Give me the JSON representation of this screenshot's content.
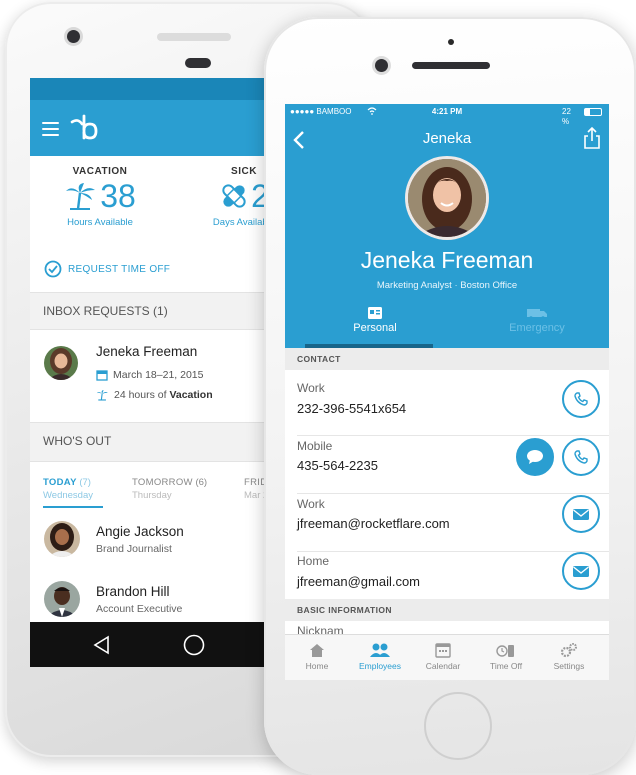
{
  "colors": {
    "accent": "#2a9ed1",
    "accent_dark": "#1a86b8"
  },
  "android": {
    "balances": [
      {
        "title": "VACATION",
        "value": "38",
        "subtitle": "Hours Available",
        "icon": "palm-tree-icon"
      },
      {
        "title": "SICK",
        "value": "2",
        "subtitle": "Days Available",
        "icon": "bandage-icon"
      }
    ],
    "request_time_off": "REQUEST TIME OFF",
    "inbox_header": "INBOX REQUESTS (1)",
    "inbox_request": {
      "name": "Jeneka Freeman",
      "dates": "March 18–21, 2015",
      "hours_prefix": "24 hours of ",
      "hours_type": "Vacation"
    },
    "whos_out_header": "WHO'S OUT",
    "whos_out_tabs": [
      {
        "label": "TODAY",
        "count": "(7)",
        "day": "Wednesday"
      },
      {
        "label": "TOMORROW",
        "count": "(6)",
        "day": "Thursday"
      },
      {
        "label": "FRID",
        "count": "",
        "day": "Mar 2"
      }
    ],
    "people": [
      {
        "name": "Angie Jackson",
        "title": "Brand Journalist"
      },
      {
        "name": "Brandon Hill",
        "title": "Account Executive"
      }
    ]
  },
  "ios": {
    "status": {
      "carrier": "●●●●● BAMBOO",
      "time": "4:21 PM",
      "battery": "22 %"
    },
    "title": "Jeneka",
    "name": "Jeneka Freeman",
    "job_title": "Marketing Analyst",
    "location": "Boston Office",
    "tabs": [
      {
        "label": "Personal",
        "active": true
      },
      {
        "label": "Emergency",
        "active": false
      }
    ],
    "contact_header": "CONTACT",
    "contacts": [
      {
        "label": "Work",
        "value": "232-396-5541x654",
        "actions": [
          "phone-icon"
        ]
      },
      {
        "label": "Mobile",
        "value": "435-564-2235",
        "actions": [
          "chat-icon",
          "phone-icon"
        ]
      },
      {
        "label": "Work",
        "value": "jfreeman@rocketflare.com",
        "actions": [
          "mail-icon"
        ]
      },
      {
        "label": "Home",
        "value": "jfreeman@gmail.com",
        "actions": [
          "mail-icon"
        ]
      }
    ],
    "basic_header": "BASIC INFORMATION",
    "nickname_label": "Nicknam",
    "tabbar": [
      {
        "label": "Home",
        "icon": "home-icon"
      },
      {
        "label": "Employees",
        "icon": "people-icon",
        "active": true
      },
      {
        "label": "Calendar",
        "icon": "calendar-icon"
      },
      {
        "label": "Time Off",
        "icon": "time-off-icon"
      },
      {
        "label": "Settings",
        "icon": "gear-icon"
      }
    ]
  }
}
